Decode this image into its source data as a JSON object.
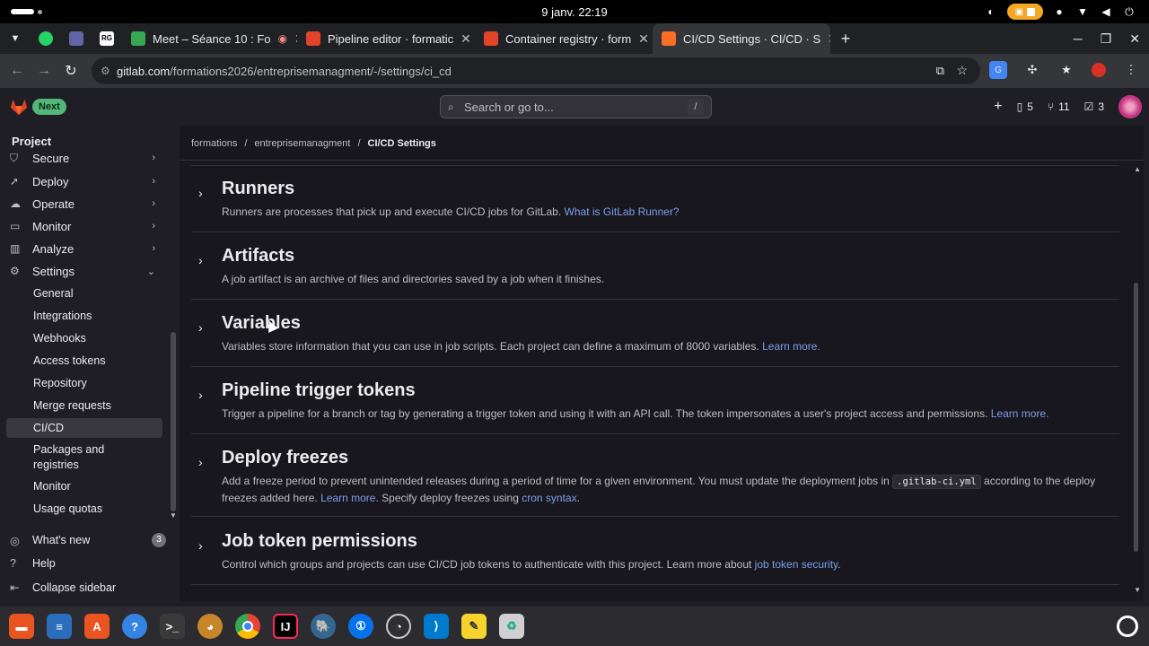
{
  "os": {
    "clock": "9 janv.  22:19"
  },
  "browser": {
    "tabs": [
      {
        "label": "Meet – Séance 10 : Fo",
        "favicon_color": "#34a853"
      },
      {
        "label": "Pipeline editor · formatic",
        "favicon_color": "#e24329"
      },
      {
        "label": "Container registry · form",
        "favicon_color": "#e24329"
      },
      {
        "label": "CI/CD Settings · CI/CD · S",
        "favicon_color": "#fc6d26"
      }
    ],
    "url_host": "gitlab.com",
    "url_path": "/formations2026/entreprisemanagment/-/settings/ci_cd"
  },
  "header": {
    "next_badge": "Next",
    "search_placeholder": "Search or go to...",
    "search_shortcut": "/",
    "issues_count": "5",
    "mr_count": "11",
    "todo_count": "3"
  },
  "sidebar": {
    "title": "Project",
    "items": [
      {
        "label": "Secure",
        "icon": "shield-icon"
      },
      {
        "label": "Deploy",
        "icon": "rocket-icon"
      },
      {
        "label": "Operate",
        "icon": "cloud-icon"
      },
      {
        "label": "Monitor",
        "icon": "monitor-icon"
      },
      {
        "label": "Analyze",
        "icon": "chart-icon"
      },
      {
        "label": "Settings",
        "icon": "gear-icon"
      }
    ],
    "settings_sub": [
      "General",
      "Integrations",
      "Webhooks",
      "Access tokens",
      "Repository",
      "Merge requests",
      "CI/CD",
      "Packages and registries",
      "Monitor",
      "Usage quotas"
    ],
    "whats_new": "What's new",
    "whats_new_count": "3",
    "help": "Help",
    "collapse": "Collapse sidebar"
  },
  "breadcrumb": {
    "items": [
      "formations",
      "entreprisemanagment",
      "CI/CD Settings"
    ]
  },
  "sections": {
    "runners": {
      "title": "Runners",
      "desc": "Runners are processes that pick up and execute CI/CD jobs for GitLab.",
      "link": "What is GitLab Runner?"
    },
    "artifacts": {
      "title": "Artifacts",
      "desc": "A job artifact is an archive of files and directories saved by a job when it finishes."
    },
    "variables": {
      "title": "Variables",
      "desc": "Variables store information that you can use in job scripts. Each project can define a maximum of 8000 variables.",
      "link": "Learn more."
    },
    "trigger": {
      "title": "Pipeline trigger tokens",
      "desc": "Trigger a pipeline for a branch or tag by generating a trigger token and using it with an API call. The token impersonates a user's project access and permissions.",
      "link": "Learn more."
    },
    "freeze": {
      "title": "Deploy freezes",
      "desc1": "Add a freeze period to prevent unintended releases during a period of time for a given environment. You must update the deployment jobs in",
      "code": ".gitlab-ci.yml",
      "desc2": "according to the deploy freezes added here.",
      "link1": "Learn more.",
      "desc3": "Specify deploy freezes using",
      "link2": "cron syntax",
      "desc4": "."
    },
    "jobtoken": {
      "title": "Job token permissions",
      "desc": "Control which groups and projects can use CI/CD job tokens to authenticate with this project. Learn more about",
      "link": "job token security",
      "tail": "."
    }
  }
}
